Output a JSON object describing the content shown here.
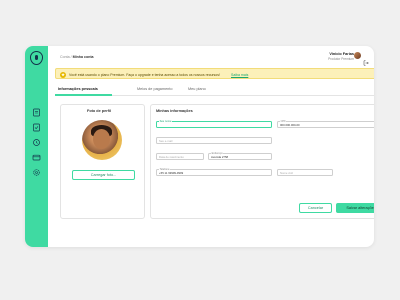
{
  "breadcrumb": {
    "parent": "Conta",
    "separator": " / ",
    "current": "Minha conta"
  },
  "user": {
    "name": "Vinicio Farias",
    "role": "Produtor Premium"
  },
  "banner": {
    "icon": "star-icon",
    "text": "Você está usando o plano Premium. Faça o upgrade e tenha acesso a todos os nossos recursos!",
    "link": "Saiba mais",
    "close": "×"
  },
  "tabs": [
    {
      "label": "Informações pessoais",
      "active": true
    },
    {
      "label": "Meios de pagamento",
      "active": false
    },
    {
      "label": "Meu plano",
      "active": false
    }
  ],
  "profile": {
    "title": "Foto de perfil",
    "upload_label": "Carregar foto..."
  },
  "form": {
    "title": "Minhas informações",
    "fields": {
      "name": {
        "label": "Seu nome",
        "value": ""
      },
      "cpf": {
        "label": "CPF",
        "value": "000.000.000-00"
      },
      "email": {
        "label": "Seu e-mail",
        "value": ""
      },
      "birth": {
        "label": "Data de nascimento",
        "value": ""
      },
      "address": {
        "label": "Endereço",
        "value": "Avenida 2758"
      },
      "phone": {
        "label": "Telefone",
        "value": "+55 11 99999-9999"
      },
      "extra": {
        "label": "",
        "value": "Nome civil"
      }
    },
    "cancel_label": "Cancelar",
    "save_label": "Salvar alterações"
  },
  "sidebar": {
    "items": [
      {
        "icon": "document-icon"
      },
      {
        "icon": "checklist-icon"
      },
      {
        "icon": "history-icon"
      },
      {
        "icon": "card-icon"
      },
      {
        "icon": "settings-icon"
      }
    ]
  },
  "colors": {
    "accent": "#3fdaa2",
    "banner_bg": "#fcf0b9",
    "dark": "#13314a"
  }
}
